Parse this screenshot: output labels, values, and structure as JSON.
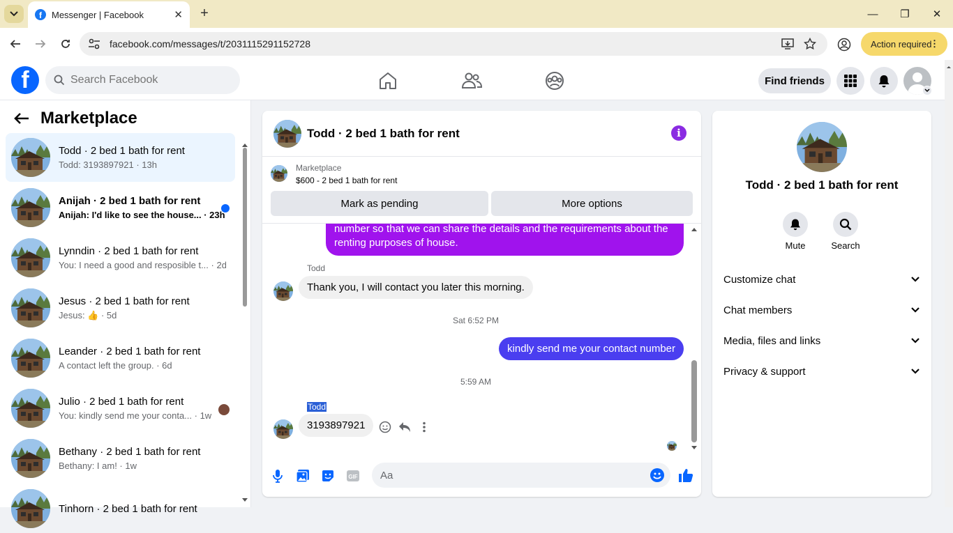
{
  "browser": {
    "tab_title": "Messenger | Facebook",
    "url": "facebook.com/messages/t/2031115291152728",
    "action_required": "Action required"
  },
  "fb": {
    "search_placeholder": "Search Facebook",
    "find_friends": "Find friends"
  },
  "sidebar": {
    "title": "Marketplace",
    "conversations": [
      {
        "name": "Todd · 2 bed 1 bath for rent",
        "preview": "Todd: 3193897921 · 13h",
        "active": true
      },
      {
        "name": "Anijah · 2 bed 1 bath for rent",
        "preview": "Anijah: I'd like to see the house... · 23h",
        "unread": true
      },
      {
        "name": "Lynndin · 2 bed 1 bath for rent",
        "preview": "You: I need a good and resposible t... · 2d"
      },
      {
        "name": "Jesus · 2 bed 1 bath for rent",
        "preview": "Jesus: 👍 · 5d"
      },
      {
        "name": "Leander · 2 bed 1 bath for rent",
        "preview": "A contact left the group. · 6d"
      },
      {
        "name": "Julio · 2 bed 1 bath for rent",
        "preview": "You: kindly send me your conta... · 1w"
      },
      {
        "name": "Bethany · 2 bed 1 bath for rent",
        "preview": "Bethany: I am! · 1w"
      },
      {
        "name": "Tinhorn · 2 bed 1 bath for rent",
        "preview": ""
      }
    ]
  },
  "chat": {
    "title": "Todd · 2 bed 1 bath for rent",
    "marketplace_label": "Marketplace",
    "listing": "$600 - 2 bed 1 bath for rent",
    "mark_pending": "Mark as pending",
    "more_options": "More options",
    "messages": {
      "out1_line1": "number so that we can share the details and the requirements about the",
      "out1_line2": "renting purposes of house.",
      "sender1": "Todd",
      "in1": "Thank you, I will contact you later this morning.",
      "time1": "Sat 6:52 PM",
      "out2": "kindly send me your contact number",
      "time2": "5:59 AM",
      "sender2": "Todd",
      "in2": "3193897921"
    },
    "compose_placeholder": "Aa"
  },
  "right_panel": {
    "name": "Todd · 2 bed 1 bath for rent",
    "mute": "Mute",
    "search": "Search",
    "sections": [
      "Customize chat",
      "Chat members",
      "Media, files and links",
      "Privacy & support"
    ]
  }
}
